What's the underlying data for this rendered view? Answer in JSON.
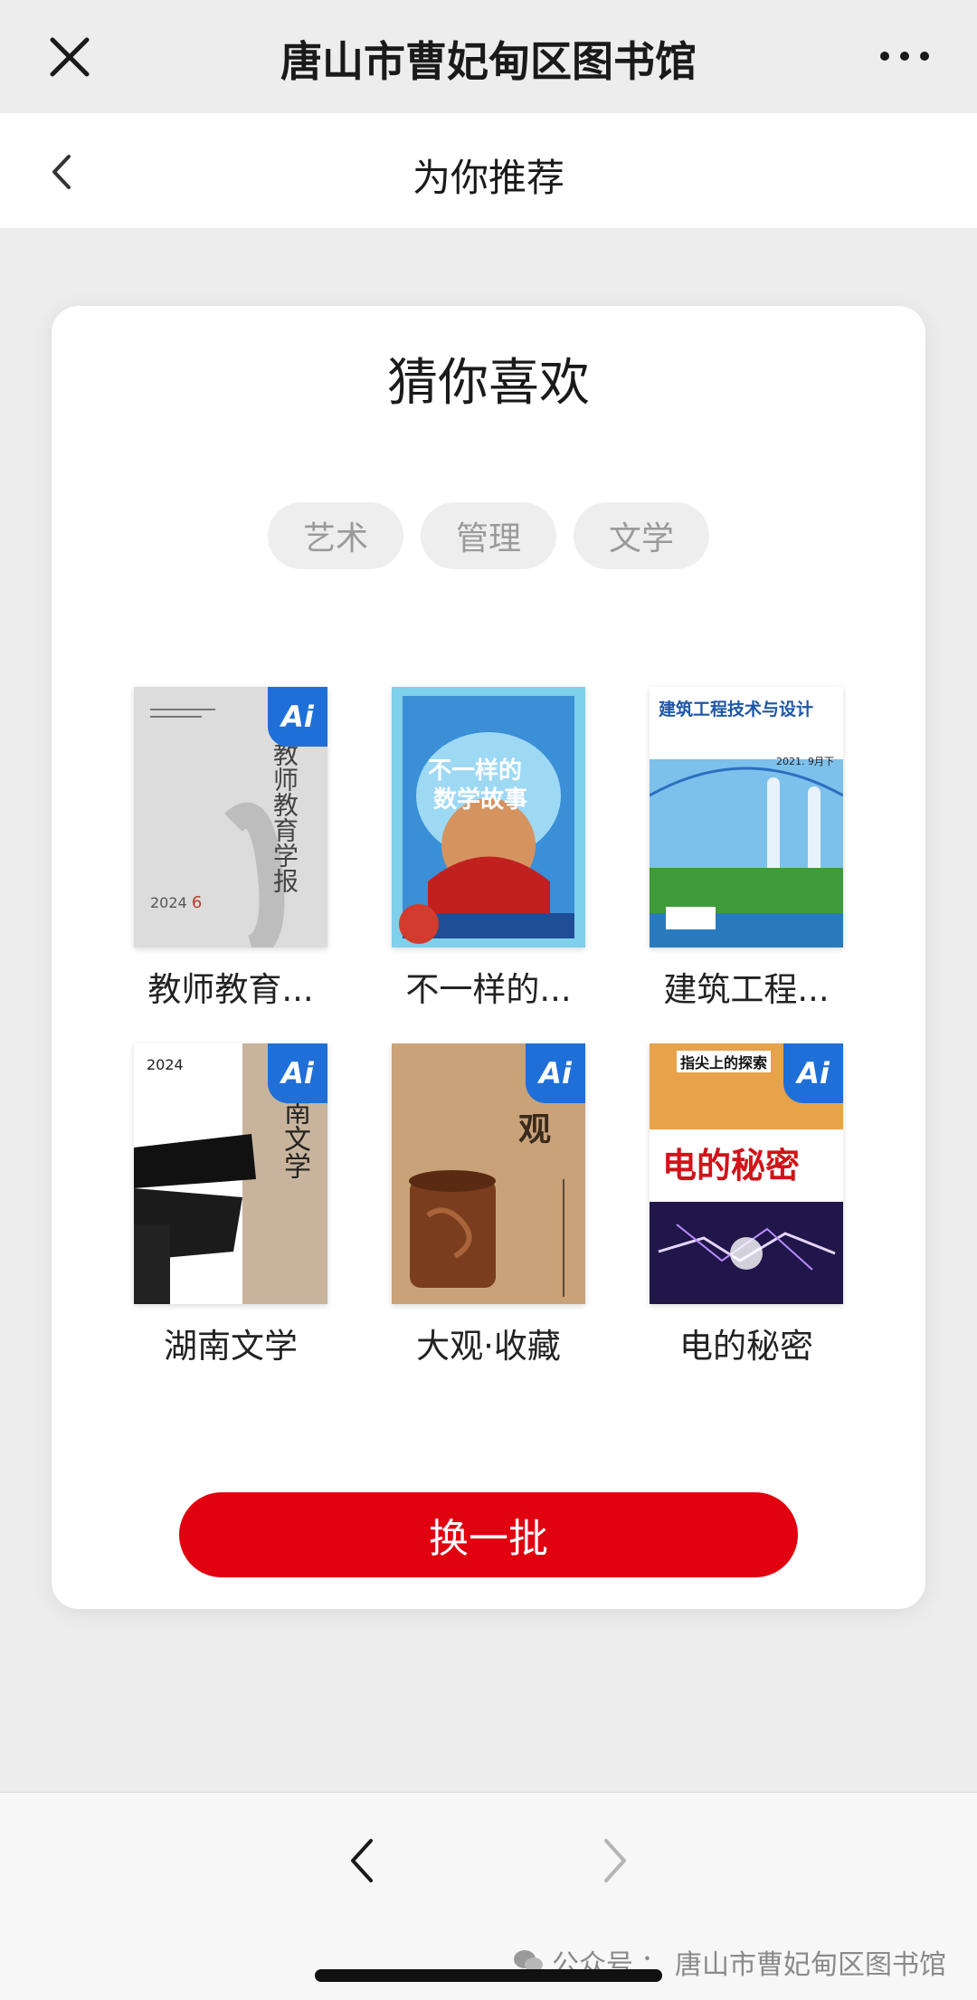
{
  "topbar": {
    "title": "唐山市曹妃甸区图书馆"
  },
  "subbar": {
    "title": "为你推荐"
  },
  "card": {
    "heading": "猜你喜欢",
    "chips": [
      "艺术",
      "管理",
      "文学"
    ],
    "books": [
      {
        "title": "教师教育...",
        "ai_badge": "Ai"
      },
      {
        "title": "不一样的...",
        "ai_badge": ""
      },
      {
        "title": "建筑工程...",
        "ai_badge": ""
      },
      {
        "title": "湖南文学",
        "ai_badge": "Ai"
      },
      {
        "title": "大观·收藏",
        "ai_badge": "Ai"
      },
      {
        "title": "电的秘密",
        "ai_badge": "Ai"
      }
    ],
    "refresh_label": "换一批"
  },
  "cover_text": {
    "b1_year": "2024",
    "b1_issue": "6",
    "b1_vertical": "教师教育学报",
    "b2_line1": "不一样的",
    "b2_line2": "数学故事",
    "b3_title": "建筑工程技术与设计",
    "b3_date": "2021. 9月下",
    "b4_year": "2024",
    "b4_vertical": "南文学",
    "b5_vertical": "观",
    "b6_top": "指尖上的探索",
    "b6_title": "电的秘密"
  },
  "watermark": {
    "prefix": "公众号",
    "name": "唐山市曹妃甸区图书馆"
  }
}
